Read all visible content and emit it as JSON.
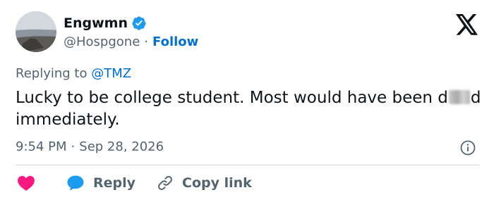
{
  "author": {
    "name": "Engwmn",
    "handle": "@Hospgone",
    "separator": "·",
    "follow_label": "Follow"
  },
  "reply_context": {
    "prefix": "Replying to",
    "mention": "@TMZ"
  },
  "tweet": {
    "text_before": "Lucky to be college student. Most would have been d",
    "text_after": "d immediately.",
    "time": "9:54 PM",
    "separator": "·",
    "date": "Sep 28, 2026"
  },
  "actions": {
    "reply_label": "Reply",
    "copy_label": "Copy link"
  },
  "icons": {
    "verified": "verified-badge-icon",
    "logo": "x-logo-icon",
    "info": "info-icon",
    "like": "heart-icon",
    "reply": "speech-bubble-icon",
    "copy": "link-icon"
  },
  "colors": {
    "link_blue": "#006fd6",
    "verified_blue": "#1d9bf0",
    "heart_pink": "#f91880",
    "secondary_text": "#536471",
    "primary_text": "#0f1419"
  }
}
